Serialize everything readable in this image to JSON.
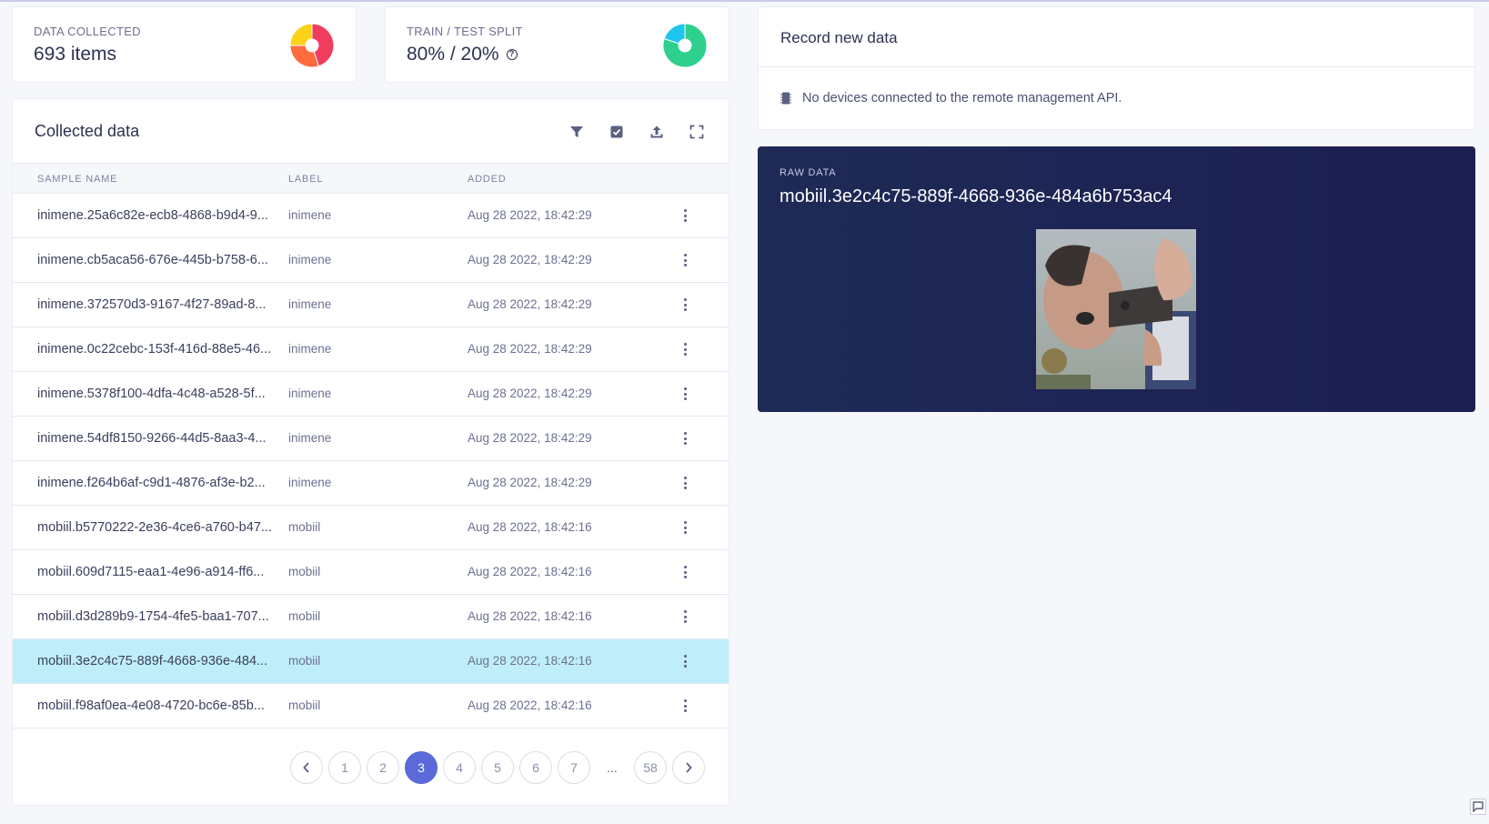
{
  "stats": {
    "data_collected": {
      "label": "DATA COLLECTED",
      "value": "693 items",
      "donut_colors": [
        "#f23c5e",
        "#ff6b3d",
        "#ffd21a"
      ]
    },
    "train_test_split": {
      "label": "TRAIN / TEST SPLIT",
      "value": "80% / 20%",
      "train_fraction": 0.8,
      "donut_colors": [
        "#2dd08c",
        "#1fc6ee"
      ]
    }
  },
  "collected_data": {
    "title": "Collected data",
    "toolbar_icons": [
      "filter-icon",
      "checkbox-icon",
      "upload-icon",
      "expand-icon"
    ],
    "columns": {
      "name": "SAMPLE NAME",
      "label": "LABEL",
      "added": "ADDED"
    },
    "rows": [
      {
        "name": "inimene.25a6c82e-ecb8-4868-b9d4-9...",
        "label": "inimene",
        "added": "Aug 28 2022, 18:42:29"
      },
      {
        "name": "inimene.cb5aca56-676e-445b-b758-6...",
        "label": "inimene",
        "added": "Aug 28 2022, 18:42:29"
      },
      {
        "name": "inimene.372570d3-9167-4f27-89ad-8...",
        "label": "inimene",
        "added": "Aug 28 2022, 18:42:29"
      },
      {
        "name": "inimene.0c22cebc-153f-416d-88e5-46...",
        "label": "inimene",
        "added": "Aug 28 2022, 18:42:29"
      },
      {
        "name": "inimene.5378f100-4dfa-4c48-a528-5f...",
        "label": "inimene",
        "added": "Aug 28 2022, 18:42:29"
      },
      {
        "name": "inimene.54df8150-9266-44d5-8aa3-4...",
        "label": "inimene",
        "added": "Aug 28 2022, 18:42:29"
      },
      {
        "name": "inimene.f264b6af-c9d1-4876-af3e-b2...",
        "label": "inimene",
        "added": "Aug 28 2022, 18:42:29"
      },
      {
        "name": "mobiil.b5770222-2e36-4ce6-a760-b47...",
        "label": "mobiil",
        "added": "Aug 28 2022, 18:42:16"
      },
      {
        "name": "mobiil.609d7115-eaa1-4e96-a914-ff6...",
        "label": "mobiil",
        "added": "Aug 28 2022, 18:42:16"
      },
      {
        "name": "mobiil.d3d289b9-1754-4fe5-baa1-707...",
        "label": "mobiil",
        "added": "Aug 28 2022, 18:42:16"
      },
      {
        "name": "mobiil.3e2c4c75-889f-4668-936e-484...",
        "label": "mobiil",
        "added": "Aug 28 2022, 18:42:16",
        "selected": true
      },
      {
        "name": "mobiil.f98af0ea-4e08-4720-bc6e-85b...",
        "label": "mobiil",
        "added": "Aug 28 2022, 18:42:16"
      }
    ],
    "pagination": {
      "pages": [
        "1",
        "2",
        "3",
        "4",
        "5",
        "6",
        "7",
        "...",
        "58"
      ],
      "current": "3"
    }
  },
  "record_new": {
    "title": "Record new data",
    "message": "No devices connected to the remote management API."
  },
  "raw_data": {
    "label": "RAW DATA",
    "title": "mobiil.3e2c4c75-889f-4668-936e-484a6b753ac4"
  },
  "colors": {
    "accent": "#5b6ad8",
    "selected_row": "#bfeefa",
    "raw_panel": "#1e2452"
  }
}
